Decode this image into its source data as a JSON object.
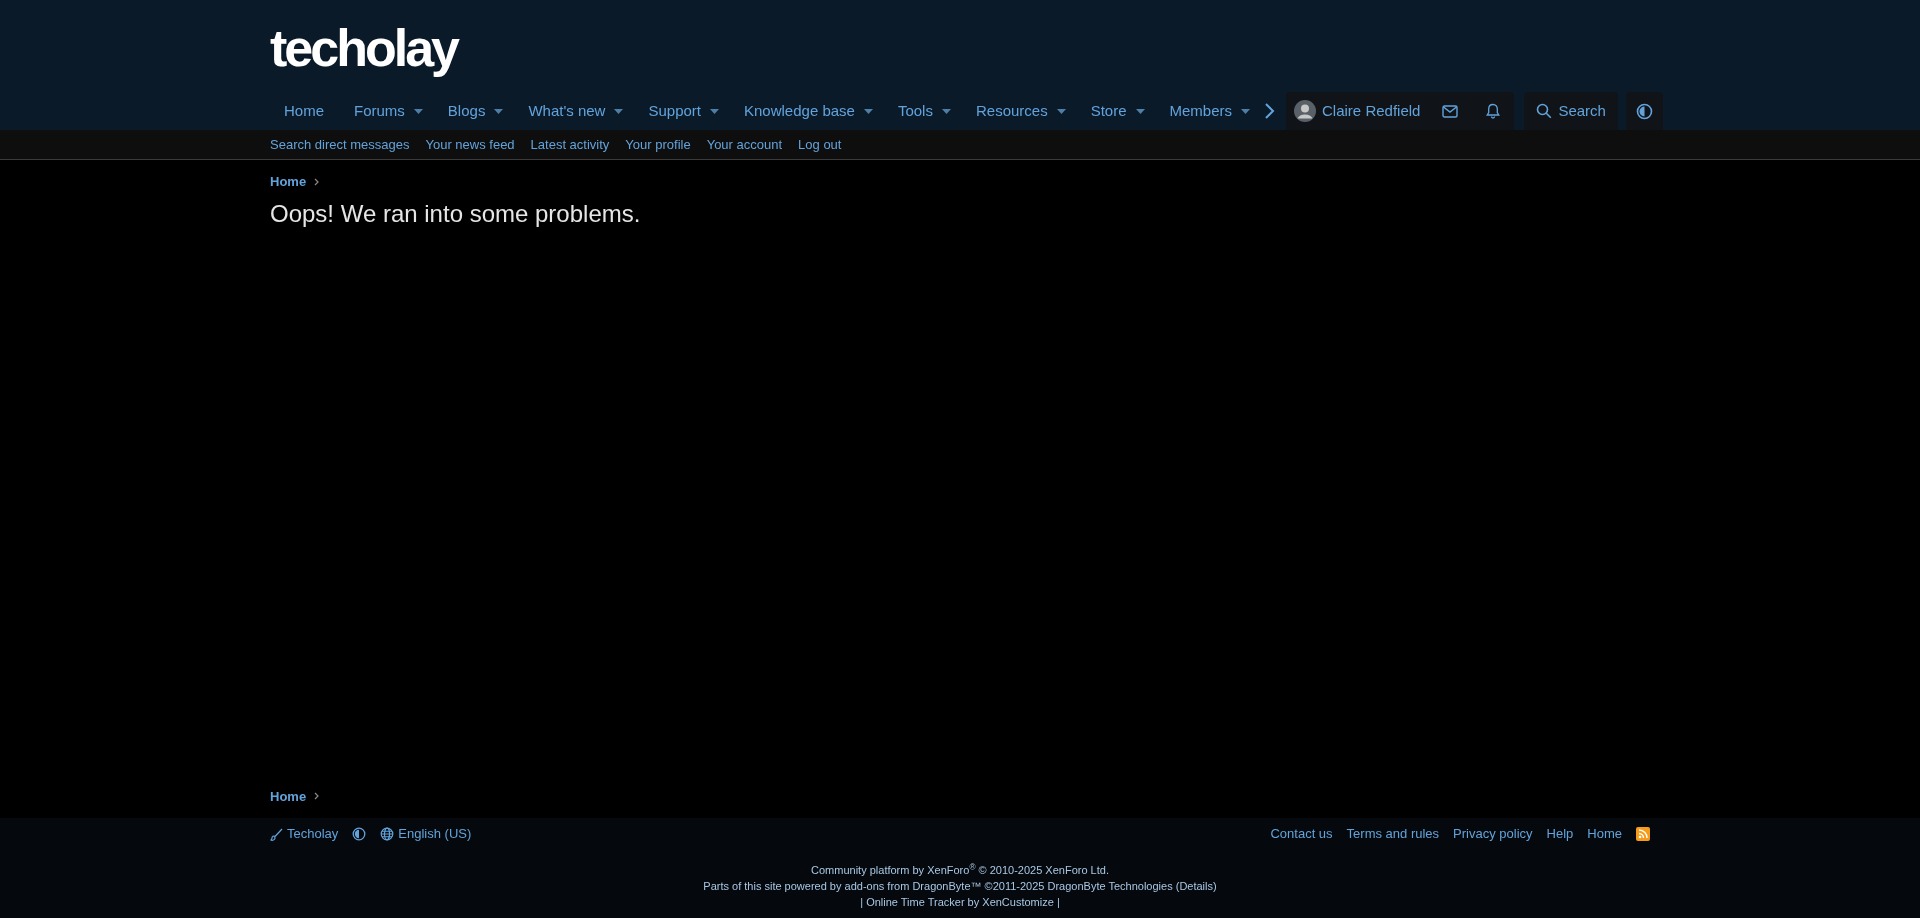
{
  "logo": "techolay",
  "nav": [
    {
      "label": "Home",
      "has_menu": false
    },
    {
      "label": "Forums",
      "has_menu": true
    },
    {
      "label": "Blogs",
      "has_menu": true
    },
    {
      "label": "What's new",
      "has_menu": true
    },
    {
      "label": "Support",
      "has_menu": true
    },
    {
      "label": "Knowledge base",
      "has_menu": true
    },
    {
      "label": "Tools",
      "has_menu": true
    },
    {
      "label": "Resources",
      "has_menu": true
    },
    {
      "label": "Store",
      "has_menu": true
    },
    {
      "label": "Members",
      "has_menu": true
    }
  ],
  "user": {
    "name": "Claire Redfield"
  },
  "search": {
    "label": "Search"
  },
  "subnav": [
    "Search direct messages",
    "Your news feed",
    "Latest activity",
    "Your profile",
    "Your account",
    "Log out"
  ],
  "breadcrumb_top": [
    "Home"
  ],
  "page_title": "Oops! We ran into some problems.",
  "breadcrumb_bottom": [
    "Home"
  ],
  "footer": {
    "style": "Techolay",
    "language": "English (US)",
    "links": [
      "Contact us",
      "Terms and rules",
      "Privacy policy",
      "Help",
      "Home"
    ],
    "copyright": [
      "Community platform by XenForo$^{®}$ © 2010-2025 XenForo Ltd.",
      "Parts of this site powered by add-ons from DragonByte™ ©2011-2025 DragonByte Technologies (Details)",
      "| Online Time Tracker by XenCustomize |"
    ]
  }
}
